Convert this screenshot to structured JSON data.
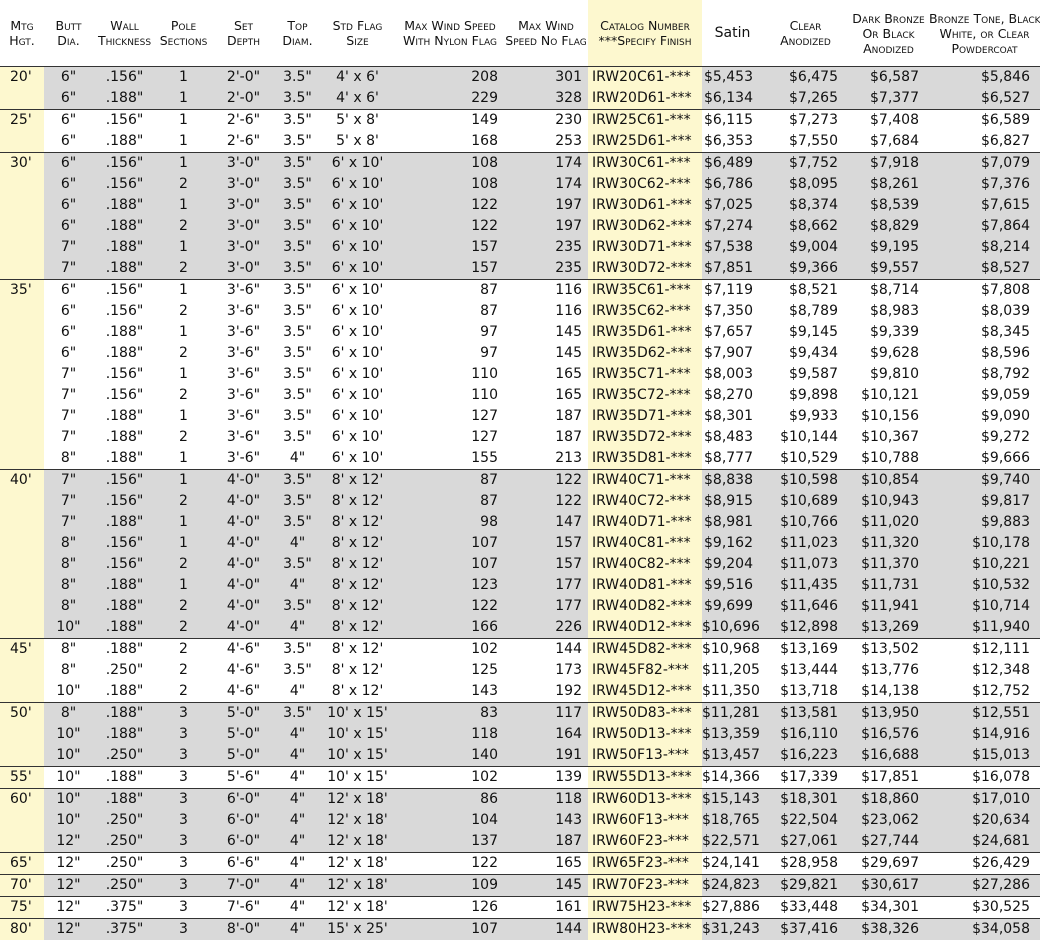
{
  "headers": [
    [
      "Mtg",
      "Hgt."
    ],
    [
      "Butt",
      "Dia."
    ],
    [
      "Wall",
      "Thickness"
    ],
    [
      "Pole",
      "Sections"
    ],
    [
      "Set",
      "Depth"
    ],
    [
      "Top",
      "Diam."
    ],
    [
      "Std Flag",
      "Size"
    ],
    [
      "Max Wind Speed",
      "With Nylon Flag"
    ],
    [
      "Max Wind",
      "Speed No Flag"
    ],
    [
      "Catalog Number",
      "***Specify Finish"
    ],
    [
      "Satin"
    ],
    [
      "Clear",
      "Anodized"
    ],
    [
      "Dark Bronze",
      "Or Black",
      "Anodized"
    ],
    [
      "Bronze Tone, Black,",
      "White, or Clear",
      "Powdercoat"
    ]
  ],
  "rows": [
    [
      "20'",
      "6\"",
      ".156\"",
      "1",
      "2'-0\"",
      "3.5\"",
      "4' x 6'",
      "208",
      "301",
      "IRW20C61-***",
      "$5,453",
      "$6,475",
      "$6,587",
      "$5,846"
    ],
    [
      "",
      "6\"",
      ".188\"",
      "1",
      "2'-0\"",
      "3.5\"",
      "4' x 6'",
      "229",
      "328",
      "IRW20D61-***",
      "$6,134",
      "$7,265",
      "$7,377",
      "$6,527"
    ],
    [
      "25'",
      "6\"",
      ".156\"",
      "1",
      "2'-6\"",
      "3.5\"",
      "5' x 8'",
      "149",
      "230",
      "IRW25C61-***",
      "$6,115",
      "$7,273",
      "$7,408",
      "$6,589"
    ],
    [
      "",
      "6\"",
      ".188\"",
      "1",
      "2'-6\"",
      "3.5\"",
      "5' x 8'",
      "168",
      "253",
      "IRW25D61-***",
      "$6,353",
      "$7,550",
      "$7,684",
      "$6,827"
    ],
    [
      "30'",
      "6\"",
      ".156\"",
      "1",
      "3'-0\"",
      "3.5\"",
      "6' x 10'",
      "108",
      "174",
      "IRW30C61-***",
      "$6,489",
      "$7,752",
      "$7,918",
      "$7,079"
    ],
    [
      "",
      "6\"",
      ".156\"",
      "2",
      "3'-0\"",
      "3.5\"",
      "6' x 10'",
      "108",
      "174",
      "IRW30C62-***",
      "$6,786",
      "$8,095",
      "$8,261",
      "$7,376"
    ],
    [
      "",
      "6\"",
      ".188\"",
      "1",
      "3'-0\"",
      "3.5\"",
      "6' x 10'",
      "122",
      "197",
      "IRW30D61-***",
      "$7,025",
      "$8,374",
      "$8,539",
      "$7,615"
    ],
    [
      "",
      "6\"",
      ".188\"",
      "2",
      "3'-0\"",
      "3.5\"",
      "6' x 10'",
      "122",
      "197",
      "IRW30D62-***",
      "$7,274",
      "$8,662",
      "$8,829",
      "$7,864"
    ],
    [
      "",
      "7\"",
      ".188\"",
      "1",
      "3'-0\"",
      "3.5\"",
      "6' x 10'",
      "157",
      "235",
      "IRW30D71-***",
      "$7,538",
      "$9,004",
      "$9,195",
      "$8,214"
    ],
    [
      "",
      "7\"",
      ".188\"",
      "2",
      "3'-0\"",
      "3.5\"",
      "6' x 10'",
      "157",
      "235",
      "IRW30D72-***",
      "$7,851",
      "$9,366",
      "$9,557",
      "$8,527"
    ],
    [
      "35'",
      "6\"",
      ".156\"",
      "1",
      "3'-6\"",
      "3.5\"",
      "6' x 10'",
      "87",
      "116",
      "IRW35C61-***",
      "$7,119",
      "$8,521",
      "$8,714",
      "$7,808"
    ],
    [
      "",
      "6\"",
      ".156\"",
      "2",
      "3'-6\"",
      "3.5\"",
      "6' x 10'",
      "87",
      "116",
      "IRW35C62-***",
      "$7,350",
      "$8,789",
      "$8,983",
      "$8,039"
    ],
    [
      "",
      "6\"",
      ".188\"",
      "1",
      "3'-6\"",
      "3.5\"",
      "6' x 10'",
      "97",
      "145",
      "IRW35D61-***",
      "$7,657",
      "$9,145",
      "$9,339",
      "$8,345"
    ],
    [
      "",
      "6\"",
      ".188\"",
      "2",
      "3'-6\"",
      "3.5\"",
      "6' x 10'",
      "97",
      "145",
      "IRW35D62-***",
      "$7,907",
      "$9,434",
      "$9,628",
      "$8,596"
    ],
    [
      "",
      "7\"",
      ".156\"",
      "1",
      "3'-6\"",
      "3.5\"",
      "6' x 10'",
      "110",
      "165",
      "IRW35C71-***",
      "$8,003",
      "$9,587",
      "$9,810",
      "$8,792"
    ],
    [
      "",
      "7\"",
      ".156\"",
      "2",
      "3'-6\"",
      "3.5\"",
      "6' x 10'",
      "110",
      "165",
      "IRW35C72-***",
      "$8,270",
      "$9,898",
      "$10,121",
      "$9,059"
    ],
    [
      "",
      "7\"",
      ".188\"",
      "1",
      "3'-6\"",
      "3.5\"",
      "6' x 10'",
      "127",
      "187",
      "IRW35D71-***",
      "$8,301",
      "$9,933",
      "$10,156",
      "$9,090"
    ],
    [
      "",
      "7\"",
      ".188\"",
      "2",
      "3'-6\"",
      "3.5\"",
      "6' x 10'",
      "127",
      "187",
      "IRW35D72-***",
      "$8,483",
      "$10,144",
      "$10,367",
      "$9,272"
    ],
    [
      "",
      "8\"",
      ".188\"",
      "1",
      "3'-6\"",
      "4\"",
      "6' x 10'",
      "155",
      "213",
      "IRW35D81-***",
      "$8,777",
      "$10,529",
      "$10,788",
      "$9,666"
    ],
    [
      "40'",
      "7\"",
      ".156\"",
      "1",
      "4'-0\"",
      "3.5\"",
      "8' x 12'",
      "87",
      "122",
      "IRW40C71-***",
      "$8,838",
      "$10,598",
      "$10,854",
      "$9,740"
    ],
    [
      "",
      "7\"",
      ".156\"",
      "2",
      "4'-0\"",
      "3.5\"",
      "8' x 12'",
      "87",
      "122",
      "IRW40C72-***",
      "$8,915",
      "$10,689",
      "$10,943",
      "$9,817"
    ],
    [
      "",
      "7\"",
      ".188\"",
      "1",
      "4'-0\"",
      "3.5\"",
      "8' x 12'",
      "98",
      "147",
      "IRW40D71-***",
      "$8,981",
      "$10,766",
      "$11,020",
      "$9,883"
    ],
    [
      "",
      "8\"",
      ".156\"",
      "1",
      "4'-0\"",
      "4\"",
      "8' x 12'",
      "107",
      "157",
      "IRW40C81-***",
      "$9,162",
      "$11,023",
      "$11,320",
      "$10,178"
    ],
    [
      "",
      "8\"",
      ".156\"",
      "2",
      "4'-0\"",
      "3.5\"",
      "8' x 12'",
      "107",
      "157",
      "IRW40C82-***",
      "$9,204",
      "$11,073",
      "$11,370",
      "$10,221"
    ],
    [
      "",
      "8\"",
      ".188\"",
      "1",
      "4'-0\"",
      "4\"",
      "8' x 12'",
      "123",
      "177",
      "IRW40D81-***",
      "$9,516",
      "$11,435",
      "$11,731",
      "$10,532"
    ],
    [
      "",
      "8\"",
      ".188\"",
      "2",
      "4'-0\"",
      "3.5\"",
      "8' x 12'",
      "122",
      "177",
      "IRW40D82-***",
      "$9,699",
      "$11,646",
      "$11,941",
      "$10,714"
    ],
    [
      "",
      "10\"",
      ".188\"",
      "2",
      "4'-0\"",
      "4\"",
      "8' x 12'",
      "166",
      "226",
      "IRW40D12-***",
      "$10,696",
      "$12,898",
      "$13,269",
      "$11,940"
    ],
    [
      "45'",
      "8\"",
      ".188\"",
      "2",
      "4'-6\"",
      "3.5\"",
      "8' x 12'",
      "102",
      "144",
      "IRW45D82-***",
      "$10,968",
      "$13,169",
      "$13,502",
      "$12,111"
    ],
    [
      "",
      "8\"",
      ".250\"",
      "2",
      "4'-6\"",
      "3.5\"",
      "8' x 12'",
      "125",
      "173",
      "IRW45F82-***",
      "$11,205",
      "$13,444",
      "$13,776",
      "$12,348"
    ],
    [
      "",
      "10\"",
      ".188\"",
      "2",
      "4'-6\"",
      "4\"",
      "8' x 12'",
      "143",
      "192",
      "IRW45D12-***",
      "$11,350",
      "$13,718",
      "$14,138",
      "$12,752"
    ],
    [
      "50'",
      "8\"",
      ".188\"",
      "3",
      "5'-0\"",
      "3.5\"",
      "10' x 15'",
      "83",
      "117",
      "IRW50D83-***",
      "$11,281",
      "$13,581",
      "$13,950",
      "$12,551"
    ],
    [
      "",
      "10\"",
      ".188\"",
      "3",
      "5'-0\"",
      "4\"",
      "10' x 15'",
      "118",
      "164",
      "IRW50D13-***",
      "$13,359",
      "$16,110",
      "$16,576",
      "$14,916"
    ],
    [
      "",
      "10\"",
      ".250\"",
      "3",
      "5'-0\"",
      "4\"",
      "10' x 15'",
      "140",
      "191",
      "IRW50F13-***",
      "$13,457",
      "$16,223",
      "$16,688",
      "$15,013"
    ],
    [
      "55'",
      "10\"",
      ".188\"",
      "3",
      "5'-6\"",
      "4\"",
      "10' x 15'",
      "102",
      "139",
      "IRW55D13-***",
      "$14,366",
      "$17,339",
      "$17,851",
      "$16,078"
    ],
    [
      "60'",
      "10\"",
      ".188\"",
      "3",
      "6'-0\"",
      "4\"",
      "12' x 18'",
      "86",
      "118",
      "IRW60D13-***",
      "$15,143",
      "$18,301",
      "$18,860",
      "$17,010"
    ],
    [
      "",
      "10\"",
      ".250\"",
      "3",
      "6'-0\"",
      "4\"",
      "12' x 18'",
      "104",
      "143",
      "IRW60F13-***",
      "$18,765",
      "$22,504",
      "$23,062",
      "$20,634"
    ],
    [
      "",
      "12\"",
      ".250\"",
      "3",
      "6'-0\"",
      "4\"",
      "12' x 18'",
      "137",
      "187",
      "IRW60F23-***",
      "$22,571",
      "$27,061",
      "$27,744",
      "$24,681"
    ],
    [
      "65'",
      "12\"",
      ".250\"",
      "3",
      "6'-6\"",
      "4\"",
      "12' x 18'",
      "122",
      "165",
      "IRW65F23-***",
      "$24,141",
      "$28,958",
      "$29,697",
      "$26,429"
    ],
    [
      "70'",
      "12\"",
      ".250\"",
      "3",
      "7'-0\"",
      "4\"",
      "12' x 18'",
      "109",
      "145",
      "IRW70F23-***",
      "$24,823",
      "$29,821",
      "$30,617",
      "$27,286"
    ],
    [
      "75'",
      "12\"",
      ".375\"",
      "3",
      "7'-6\"",
      "4\"",
      "12' x 18'",
      "126",
      "161",
      "IRW75H23-***",
      "$27,886",
      "$33,448",
      "$34,301",
      "$30,525"
    ],
    [
      "80'",
      "12\"",
      ".375\"",
      "3",
      "8'-0\"",
      "4\"",
      "15' x 25'",
      "107",
      "144",
      "IRW80H23-***",
      "$31,243",
      "$37,416",
      "$38,326",
      "$34,058"
    ]
  ],
  "colors": {
    "highlight": "#fdf8cf",
    "shade": "#d9d9d9",
    "rule": "#333333"
  }
}
